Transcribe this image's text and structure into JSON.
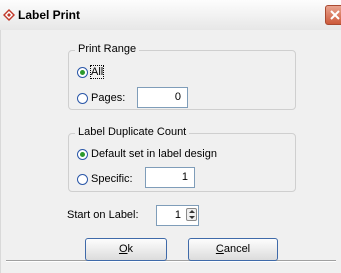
{
  "window": {
    "title": "Label Print"
  },
  "print_range": {
    "legend": "Print Range",
    "all_label": "All",
    "pages_label": "Pages:",
    "pages_value": "0",
    "selected": "all"
  },
  "duplicate": {
    "legend": "Label Duplicate Count",
    "default_label": "Default set in label design",
    "specific_label": "Specific:",
    "specific_value": "1",
    "selected": "default"
  },
  "start": {
    "label": "Start on Label:",
    "value": "1"
  },
  "buttons": {
    "ok_mnemonic": "O",
    "ok_rest": "k",
    "cancel_mnemonic": "C",
    "cancel_rest": "ancel"
  },
  "icons": {
    "app": "label-print-icon",
    "close": "close-icon",
    "spinner": "spinner-icon"
  },
  "colors": {
    "close_button": "#cd5a3b",
    "radio_dot": "#2c9a2c",
    "button_border": "#3f6aa9"
  }
}
